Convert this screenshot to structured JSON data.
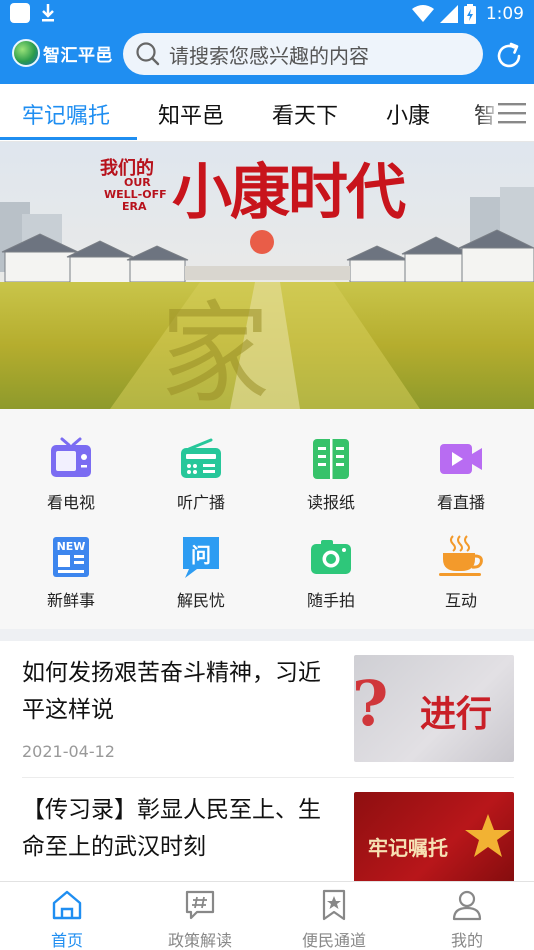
{
  "status_bar": {
    "time": "1:09"
  },
  "header": {
    "logo_text": "智汇平邑",
    "search_placeholder": "请搜索您感兴趣的内容"
  },
  "tabs": [
    {
      "label": "牢记嘱托",
      "active": true
    },
    {
      "label": "知平邑",
      "active": false
    },
    {
      "label": "看天下",
      "active": false
    },
    {
      "label": "小康",
      "active": false
    },
    {
      "label": "智",
      "active": false
    }
  ],
  "banner": {
    "headline_small": "我们的",
    "headline_en_1": "OUR",
    "headline_en_2": "WELL-OFF",
    "headline_en_3": "ERA",
    "headline_big": "小康时代"
  },
  "quick_actions": [
    {
      "label": "看电视",
      "icon": "tv-icon"
    },
    {
      "label": "听广播",
      "icon": "radio-icon"
    },
    {
      "label": "读报纸",
      "icon": "newspaper-icon"
    },
    {
      "label": "看直播",
      "icon": "live-video-icon"
    },
    {
      "label": "新鲜事",
      "icon": "news-icon"
    },
    {
      "label": "解民忧",
      "icon": "question-chat-icon"
    },
    {
      "label": "随手拍",
      "icon": "camera-icon"
    },
    {
      "label": "互动",
      "icon": "coffee-cup-icon"
    }
  ],
  "articles": [
    {
      "title": "如何发扬艰苦奋斗精神，习近平这样说",
      "date": "2021-04-12",
      "thumb_text": "进行"
    },
    {
      "title": "【传习录】彰显人民至上、生命至上的武汉时刻",
      "date": "",
      "thumb_text": "牢记嘱托"
    }
  ],
  "bottom_nav": [
    {
      "label": "首页",
      "icon": "home-icon",
      "active": true
    },
    {
      "label": "政策解读",
      "icon": "policy-chat-icon",
      "active": false
    },
    {
      "label": "便民通道",
      "icon": "bookmark-star-icon",
      "active": false
    },
    {
      "label": "我的",
      "icon": "user-icon",
      "active": false
    }
  ],
  "colors": {
    "brand_blue": "#1f8ef1",
    "tv_purple": "#7b6cf2",
    "radio_green": "#27c79a",
    "paper_green": "#37c26a",
    "live_purple": "#b86cf2",
    "news_blue": "#3d86ee",
    "help_blue": "#2d9cf2",
    "camera_green": "#2ec77a",
    "cup_orange": "#f39a2b"
  }
}
